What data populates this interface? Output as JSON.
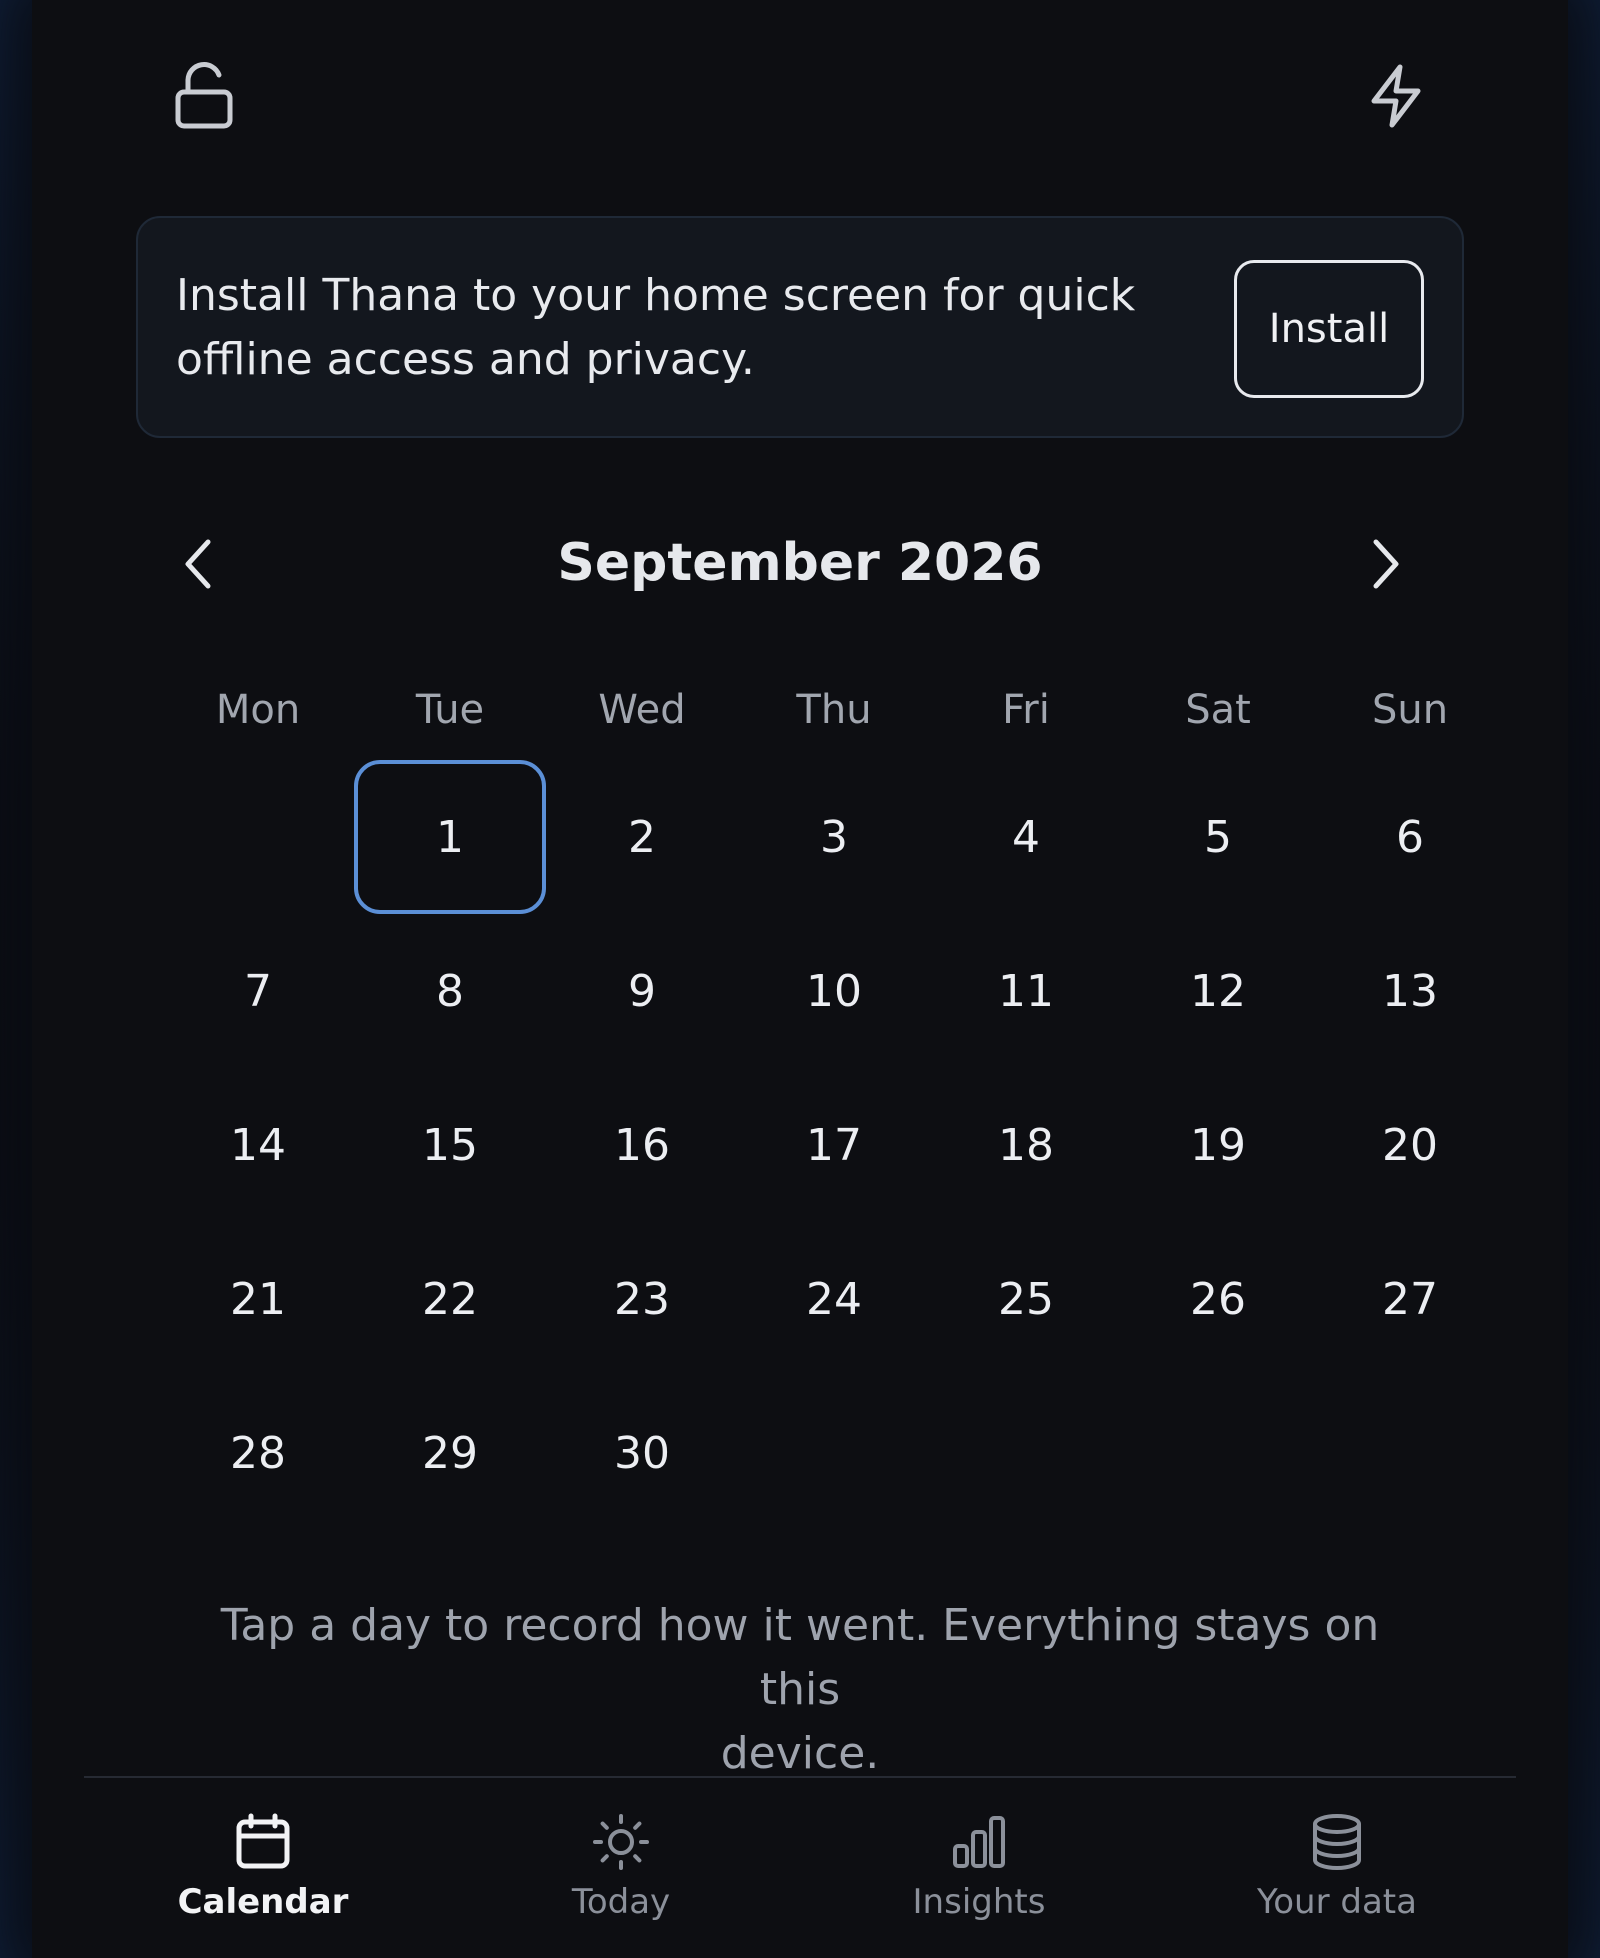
{
  "header": {
    "lock_icon": "unlock-icon",
    "bolt_icon": "lightning-icon"
  },
  "banner": {
    "message_line1": "Install Thana to your home screen for quick",
    "message_line2": "offline access and privacy.",
    "install_label": "Install"
  },
  "calendar": {
    "title": "September 2026",
    "prev_icon": "chevron-left-icon",
    "next_icon": "chevron-right-icon",
    "weekdays": [
      "Mon",
      "Tue",
      "Wed",
      "Thu",
      "Fri",
      "Sat",
      "Sun"
    ],
    "leading_blanks": 1,
    "days": [
      "1",
      "2",
      "3",
      "4",
      "5",
      "6",
      "7",
      "8",
      "9",
      "10",
      "11",
      "12",
      "13",
      "14",
      "15",
      "16",
      "17",
      "18",
      "19",
      "20",
      "21",
      "22",
      "23",
      "24",
      "25",
      "26",
      "27",
      "28",
      "29",
      "30"
    ],
    "selected_day": "1",
    "selected_color": "#5b8fd6"
  },
  "hint": {
    "line1": "Tap a day to record how it went. Everything stays on this",
    "line2": "device."
  },
  "nav": {
    "items": [
      {
        "label": "Calendar",
        "icon": "calendar-icon",
        "active": true
      },
      {
        "label": "Today",
        "icon": "sun-icon",
        "active": false
      },
      {
        "label": "Insights",
        "icon": "bar-chart-icon",
        "active": false
      },
      {
        "label": "Your data",
        "icon": "database-icon",
        "active": false
      }
    ]
  }
}
